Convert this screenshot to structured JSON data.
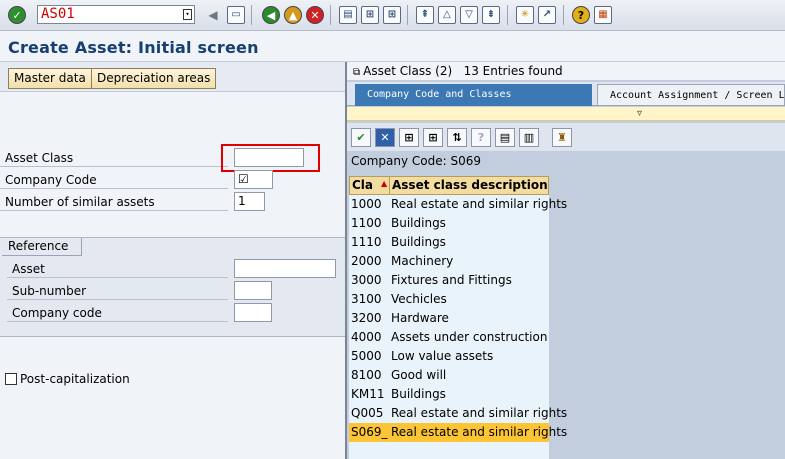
{
  "toolbar": {
    "command_value": "AS01",
    "buttons": [
      "enter-icon",
      "save-icon",
      "back-icon",
      "exit-icon",
      "cancel-icon",
      "print-icon",
      "find-icon",
      "find-next-icon",
      "first-page-icon",
      "previous-page-icon",
      "next-page-icon",
      "last-page-icon",
      "create-session-icon",
      "shortcut-icon",
      "help-icon",
      "customize-layout-icon"
    ]
  },
  "title": "Create Asset: Initial screen",
  "left": {
    "buttons": {
      "master_data": "Master data",
      "depreciation_areas": "Depreciation areas"
    },
    "fields": {
      "asset_class_label": "Asset Class",
      "asset_class_value": "",
      "company_code_label": "Company Code",
      "company_code_value": "☑",
      "num_similar_label": "Number of similar assets",
      "num_similar_value": "1"
    },
    "reference": {
      "title": "Reference",
      "asset_label": "Asset",
      "asset_value": "",
      "subnumber_label": "Sub-number",
      "subnumber_value": "",
      "company_code_label": "Company code",
      "company_code_value": ""
    },
    "post_cap_label": "Post-capitalization"
  },
  "popup": {
    "title": "Asset Class (2)   13 Entries found",
    "tabs": {
      "active": "Company Code and Classes",
      "inactive": "Account Assignment / Screen La"
    },
    "company_code_line": "Company Code: S069",
    "columns": {
      "cls": "Cla",
      "desc": "Asset class description"
    },
    "rows": [
      {
        "cls": "1000",
        "desc": "Real estate and similar rights"
      },
      {
        "cls": "1100",
        "desc": "Buildings"
      },
      {
        "cls": "1110",
        "desc": "Buildings"
      },
      {
        "cls": "2000",
        "desc": "Machinery"
      },
      {
        "cls": "3000",
        "desc": "Fixtures and Fittings"
      },
      {
        "cls": "3100",
        "desc": "Vechicles"
      },
      {
        "cls": "3200",
        "desc": "Hardware"
      },
      {
        "cls": "4000",
        "desc": "Assets under construction"
      },
      {
        "cls": "5000",
        "desc": "Low value assets"
      },
      {
        "cls": "8100",
        "desc": "Good will"
      },
      {
        "cls": "KM11",
        "desc": "Buildings"
      },
      {
        "cls": "Q005",
        "desc": "Real estate and similar rights"
      },
      {
        "cls": "S069_",
        "desc": "Real estate and similar rights"
      }
    ],
    "selected_index": 12
  },
  "colors": {
    "title": "#15406f",
    "tab_active": "#3c78b4",
    "selected_row": "#fbc535",
    "highlight_box": "#e00000"
  }
}
